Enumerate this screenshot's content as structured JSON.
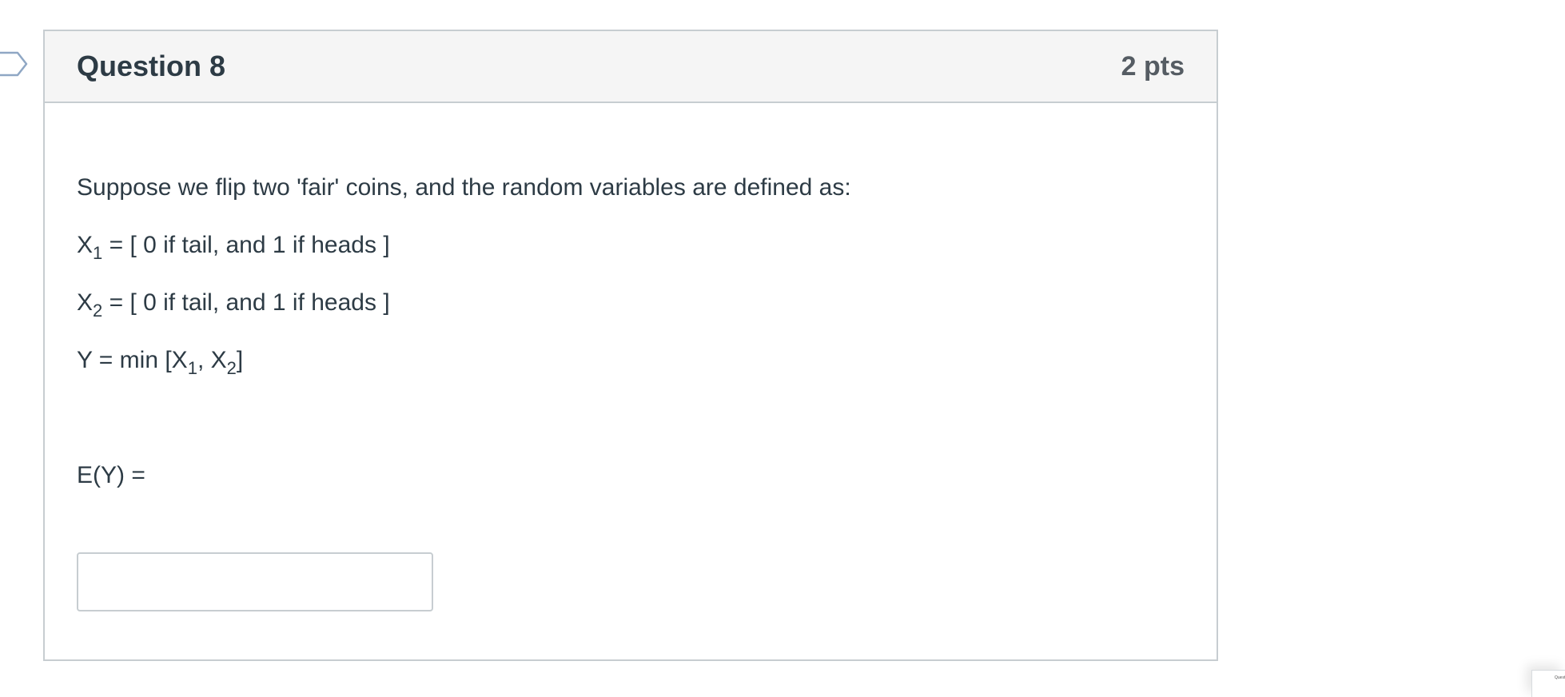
{
  "question": {
    "title": "Question 8",
    "points": "2 pts",
    "prompt": "Suppose we flip two 'fair' coins, and the random variables are defined as:",
    "x1": {
      "var": "X",
      "sub": "1",
      "definition": " = [ 0 if tail, and 1 if heads ]"
    },
    "x2": {
      "var": "X",
      "sub": "2",
      "definition": " = [ 0 if tail, and 1 if heads ]"
    },
    "y": {
      "prefix": "Y = min [X",
      "sub1": "1",
      "middle": ", X",
      "sub2": "2",
      "suffix": "]"
    },
    "ask": "E(Y) =",
    "answer_value": ""
  },
  "thumbnail": {
    "label": "Quest"
  },
  "colors": {
    "header_bg": "#f5f5f5",
    "border": "#c7cdd1",
    "text": "#2d3b45",
    "points_text": "#555c63"
  }
}
